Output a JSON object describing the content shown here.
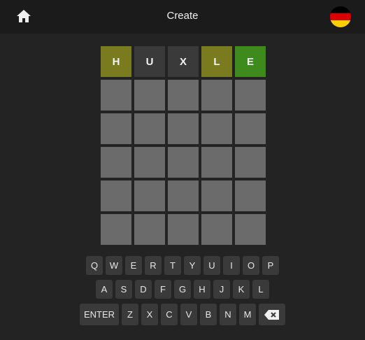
{
  "header": {
    "title": "Create",
    "home_icon": "home-icon",
    "language_icon": "german-flag-icon",
    "flag_colors": [
      "#000000",
      "#dd0000",
      "#ffce00"
    ]
  },
  "board": {
    "rows": [
      [
        {
          "letter": "H",
          "state": "present"
        },
        {
          "letter": "U",
          "state": "absent"
        },
        {
          "letter": "X",
          "state": "absent"
        },
        {
          "letter": "L",
          "state": "present"
        },
        {
          "letter": "E",
          "state": "correct"
        }
      ],
      [
        {
          "letter": "",
          "state": "empty"
        },
        {
          "letter": "",
          "state": "empty"
        },
        {
          "letter": "",
          "state": "empty"
        },
        {
          "letter": "",
          "state": "empty"
        },
        {
          "letter": "",
          "state": "empty"
        }
      ],
      [
        {
          "letter": "",
          "state": "empty"
        },
        {
          "letter": "",
          "state": "empty"
        },
        {
          "letter": "",
          "state": "empty"
        },
        {
          "letter": "",
          "state": "empty"
        },
        {
          "letter": "",
          "state": "empty"
        }
      ],
      [
        {
          "letter": "",
          "state": "empty"
        },
        {
          "letter": "",
          "state": "empty"
        },
        {
          "letter": "",
          "state": "empty"
        },
        {
          "letter": "",
          "state": "empty"
        },
        {
          "letter": "",
          "state": "empty"
        }
      ],
      [
        {
          "letter": "",
          "state": "empty"
        },
        {
          "letter": "",
          "state": "empty"
        },
        {
          "letter": "",
          "state": "empty"
        },
        {
          "letter": "",
          "state": "empty"
        },
        {
          "letter": "",
          "state": "empty"
        }
      ],
      [
        {
          "letter": "",
          "state": "empty"
        },
        {
          "letter": "",
          "state": "empty"
        },
        {
          "letter": "",
          "state": "empty"
        },
        {
          "letter": "",
          "state": "empty"
        },
        {
          "letter": "",
          "state": "empty"
        }
      ]
    ],
    "colors": {
      "present": "#7a7a1f",
      "correct": "#3f8a1c",
      "absent": "#3a3a3a",
      "empty": "#6b6b6b"
    }
  },
  "keyboard": {
    "row1": [
      "Q",
      "W",
      "E",
      "R",
      "T",
      "Y",
      "U",
      "I",
      "O",
      "P"
    ],
    "row2": [
      "A",
      "S",
      "D",
      "F",
      "G",
      "H",
      "J",
      "K",
      "L"
    ],
    "row3": [
      "Z",
      "X",
      "C",
      "V",
      "B",
      "N",
      "M"
    ],
    "enter_label": "ENTER",
    "backspace_icon": "backspace-icon"
  }
}
